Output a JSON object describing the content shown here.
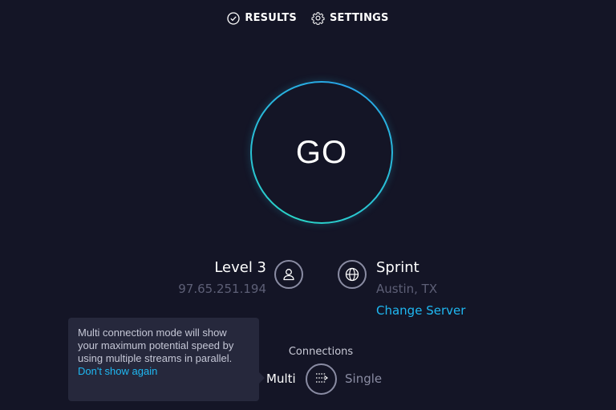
{
  "nav": {
    "results_label": "RESULTS",
    "results_icon": "check-circle-icon",
    "settings_label": "SETTINGS",
    "settings_icon": "gear-icon"
  },
  "go_button": {
    "label": "GO",
    "ring_colors": [
      "#2ad5c8",
      "#28a4e8"
    ]
  },
  "isp": {
    "name": "Level 3",
    "ip": "97.65.251.194",
    "icon": "user-icon"
  },
  "server": {
    "name": "Sprint",
    "location": "Austin, TX",
    "change_label": "Change Server",
    "icon": "globe-icon"
  },
  "connections": {
    "label": "Connections",
    "multi_label": "Multi",
    "single_label": "Single",
    "selected": "Multi",
    "toggle_icon": "multi-stream-icon"
  },
  "tooltip": {
    "text": "Multi connection mode will show your maximum potential speed by using multiple streams in parallel.",
    "dismiss_label": "Don't show again"
  },
  "colors": {
    "background": "#141526",
    "accent_link": "#1fb8f2",
    "muted_text": "#5d5f76"
  }
}
